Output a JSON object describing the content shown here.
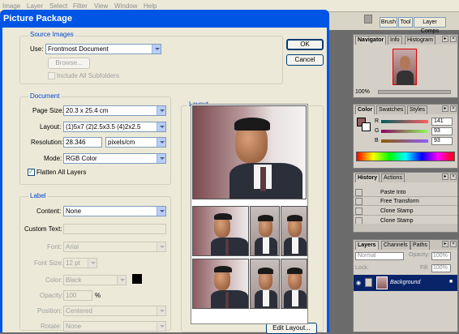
{
  "menubar": {
    "items": [
      "Image",
      "Layer",
      "Select",
      "Filter",
      "View",
      "Window",
      "Help"
    ]
  },
  "palette_well": {
    "tabs": [
      "Brush",
      "Tool",
      "Layer Comps"
    ]
  },
  "dialog": {
    "title": "Picture Package",
    "ok_label": "OK",
    "cancel_label": "Cancel",
    "source": {
      "group_label": "Source Images",
      "use_label": "Use:",
      "use_value": "Frontmost Document",
      "browse_label": "Browse...",
      "include_subfolders_label": "Include All Subfolders"
    },
    "document": {
      "group_label": "Document",
      "page_size_label": "Page Size:",
      "page_size_value": "20.3 x 25.4 cm",
      "layout_label": "Layout:",
      "layout_value": "(1)5x7 (2)2.5x3.5 (4)2x2.5",
      "resolution_label": "Resolution:",
      "resolution_value": "28.346",
      "resolution_unit": "pixels/cm",
      "mode_label": "Mode:",
      "mode_value": "RGB Color",
      "flatten_label": "Flatten All Layers",
      "flatten_checked": true
    },
    "label": {
      "group_label": "Label",
      "content_label": "Content:",
      "content_value": "None",
      "custom_text_label": "Custom Text:",
      "custom_text_value": "",
      "font_label": "Font:",
      "font_value": "Arial",
      "font_size_label": "Font Size:",
      "font_size_value": "12 pt",
      "color_label": "Color:",
      "color_value": "Black",
      "color_swatch": "#000000",
      "opacity_label": "Opacity:",
      "opacity_value": "100",
      "opacity_unit": "%",
      "position_label": "Position:",
      "position_value": "Centered",
      "rotate_label": "Rotate:",
      "rotate_value": "None"
    },
    "layout": {
      "group_label": "Layout",
      "edit_layout_label": "Edit Layout..."
    }
  },
  "navigator_panel": {
    "tabs": [
      "Navigator",
      "Info",
      "Histogram"
    ],
    "zoom": "100%"
  },
  "color_panel": {
    "tabs": [
      "Color",
      "Swatches",
      "Styles"
    ],
    "r_label": "R",
    "r_value": "141",
    "g_label": "G",
    "g_value": "93",
    "b_label": "B",
    "b_value": "93",
    "fg_color": "#8d5d5d"
  },
  "history_panel": {
    "tabs": [
      "History",
      "Actions"
    ],
    "items": [
      "Paste Into",
      "Free Transform",
      "Clone Stamp",
      "Clone Stamp"
    ]
  },
  "layers_panel": {
    "tabs": [
      "Layers",
      "Channels",
      "Paths"
    ],
    "blend_mode": "Normal",
    "opacity_label": "Opacity:",
    "opacity_value": "100%",
    "lock_label": "Lock:",
    "fill_label": "Fill:",
    "fill_value": "100%",
    "layer_name": "Background"
  },
  "colors": {
    "dialog_title": "#0055e5",
    "dialog_body": "#ece9d8",
    "group_label": "#0046d5"
  }
}
